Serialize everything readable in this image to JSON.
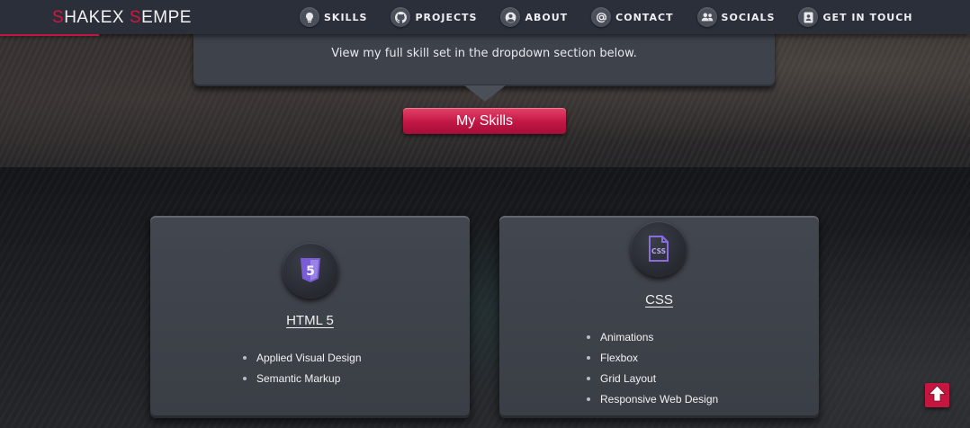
{
  "colors": {
    "accent": "#c4163f",
    "navbar": "#2b2f3a",
    "card": "#3d424b",
    "html_icon": "#7a5cd6",
    "css_icon": "#8a6be0"
  },
  "navbar": {
    "brand_first_initial": "S",
    "brand_first_rest": "HAKEX ",
    "brand_last_initial": "S",
    "brand_last_rest": "EMPE",
    "items": [
      {
        "label": "SKILLS",
        "icon": "lightbulb-icon"
      },
      {
        "label": "PROJECTS",
        "icon": "github-icon"
      },
      {
        "label": "ABOUT",
        "icon": "user-circle-icon"
      },
      {
        "label": "CONTACT",
        "icon": "at-sign-icon"
      },
      {
        "label": "SOCIALS",
        "icon": "users-icon"
      },
      {
        "label": "GET IN TOUCH",
        "icon": "contact-book-icon"
      }
    ]
  },
  "hero": {
    "info_text": "View my full skill set in the dropdown section below.",
    "button_label": "My Skills"
  },
  "skills": [
    {
      "title": "HTML 5",
      "icon": "html5-icon",
      "icon_glyph": "5",
      "items": [
        "Applied Visual Design",
        "Semantic Markup"
      ]
    },
    {
      "title": "CSS",
      "icon": "css-file-icon",
      "icon_glyph": "CSS",
      "items": [
        "Animations",
        "Flexbox",
        "Grid Layout",
        "Responsive Web Design"
      ]
    }
  ],
  "back_to_top": {
    "icon": "arrow-up-icon"
  }
}
